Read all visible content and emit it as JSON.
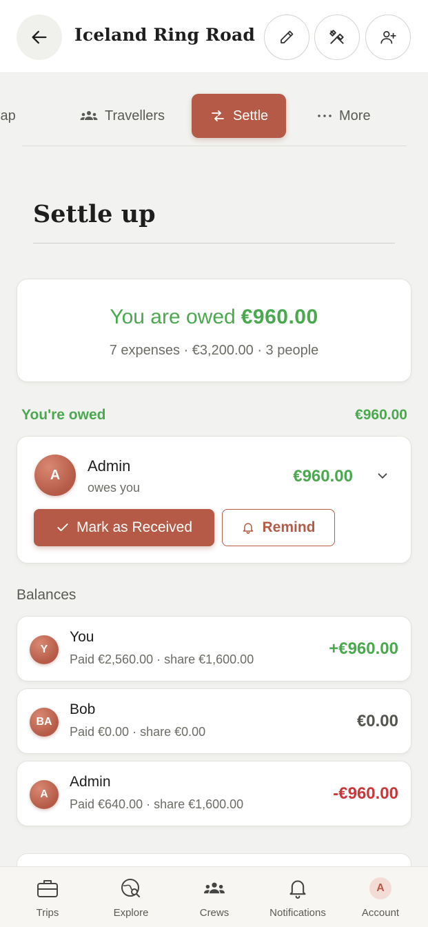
{
  "header": {
    "title": "Iceland Ring Road",
    "back_icon": "arrow-left-icon",
    "actions": [
      "pencil-icon",
      "tools-icon",
      "add-user-icon"
    ]
  },
  "tabs": [
    {
      "label": "lap",
      "icon": "map-icon"
    },
    {
      "label": "Travellers",
      "icon": "people-icon"
    },
    {
      "label": "Settle",
      "icon": "swap-arrows-icon",
      "active": true
    },
    {
      "label": "More",
      "icon": "dots-icon"
    }
  ],
  "page_title": "Settle up",
  "summary": {
    "label": "You are owed",
    "amount": "€960.00",
    "details": "7 expenses · €3,200.00 · 3 people"
  },
  "owed_section": {
    "label": "You're owed",
    "total": "€960.00",
    "entry": {
      "initial": "A",
      "name": "Admin",
      "subtitle": "owes you",
      "amount": "€960.00",
      "mark_label": "Mark as Received",
      "remind_label": "Remind"
    }
  },
  "balances": {
    "label": "Balances",
    "rows": [
      {
        "initial": "Y",
        "name": "You",
        "sub": "Paid €2,560.00 · share €1,600.00",
        "amount": "+€960.00",
        "color": "#4aa84f"
      },
      {
        "initial": "BA",
        "name": "Bob",
        "sub": "Paid €0.00 · share €0.00",
        "amount": "€0.00",
        "color": "#555550"
      },
      {
        "initial": "A",
        "name": "Admin",
        "sub": "Paid €640.00 · share €1,600.00",
        "amount": "-€960.00",
        "color": "#c8373a"
      }
    ]
  },
  "bottom_nav": [
    {
      "label": "Trips",
      "icon": "briefcase-icon"
    },
    {
      "label": "Explore",
      "icon": "globe-search-icon"
    },
    {
      "label": "Crews",
      "icon": "group-icon"
    },
    {
      "label": "Notifications",
      "icon": "bell-icon"
    },
    {
      "label": "Account",
      "initial": "A"
    }
  ],
  "colors": {
    "accent": "#b45a46",
    "positive": "#4aa84f",
    "negative": "#c8373a"
  }
}
